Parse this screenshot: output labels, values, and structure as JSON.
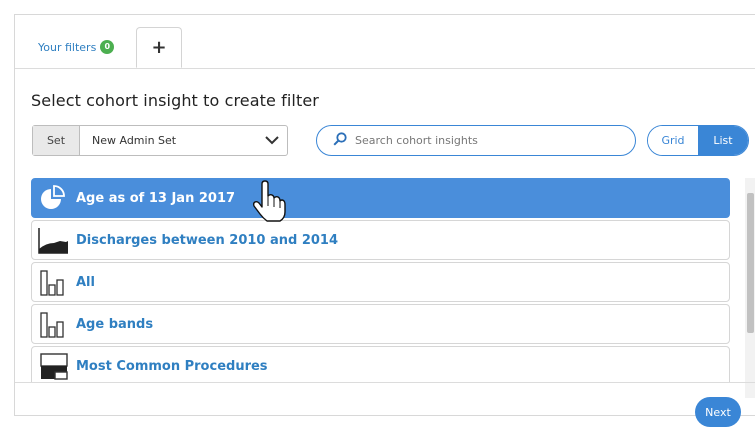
{
  "tabs": {
    "filters_label": "Your filters",
    "filters_count": "0",
    "add_label": "+"
  },
  "heading": "Select cohort insight to create filter",
  "set_select": {
    "label": "Set",
    "value": "New Admin Set"
  },
  "search": {
    "placeholder": "Search cohort insights"
  },
  "view_toggle": {
    "grid": "Grid",
    "list": "List",
    "active": "List"
  },
  "insights": [
    {
      "label": "Age as of 13 Jan 2017",
      "icon": "pie-chart-icon",
      "selected": true
    },
    {
      "label": "Discharges between 2010 and 2014",
      "icon": "area-chart-icon",
      "selected": false
    },
    {
      "label": "All",
      "icon": "bar-chart-icon",
      "selected": false
    },
    {
      "label": "Age bands",
      "icon": "bar-chart-icon",
      "selected": false
    },
    {
      "label": "Most Common Procedures",
      "icon": "treemap-icon",
      "selected": false
    }
  ],
  "footer": {
    "next": "Next"
  },
  "colors": {
    "accent": "#3a86d6",
    "selected_row": "#4a8edb",
    "link_text": "#2f7fc1",
    "badge": "#4caf50"
  }
}
